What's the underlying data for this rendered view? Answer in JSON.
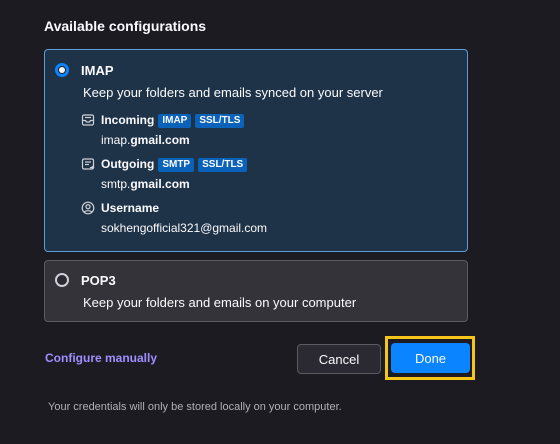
{
  "heading": "Available configurations",
  "imap": {
    "protocol": "IMAP",
    "description": "Keep your folders and emails synced on your server",
    "incoming": {
      "title": "Incoming",
      "badges": [
        "IMAP",
        "SSL/TLS"
      ],
      "host_prefix": "imap.",
      "host_domain": "gmail.com"
    },
    "outgoing": {
      "title": "Outgoing",
      "badges": [
        "SMTP",
        "SSL/TLS"
      ],
      "host_prefix": "smtp.",
      "host_domain": "gmail.com"
    },
    "username": {
      "title": "Username",
      "value": "sokhengofficial321@gmail.com"
    }
  },
  "pop3": {
    "protocol": "POP3",
    "description": "Keep your folders and emails on your computer"
  },
  "actions": {
    "configure_manually": "Configure manually",
    "cancel": "Cancel",
    "done": "Done"
  },
  "footer": "Your credentials will only be stored locally on your computer.",
  "icons": {
    "incoming": "inbox-icon",
    "outgoing": "outbox-icon",
    "username": "user-icon"
  },
  "colors": {
    "accent": "#0a84ff",
    "link": "#9f8fff",
    "highlight": "#f5c518"
  }
}
